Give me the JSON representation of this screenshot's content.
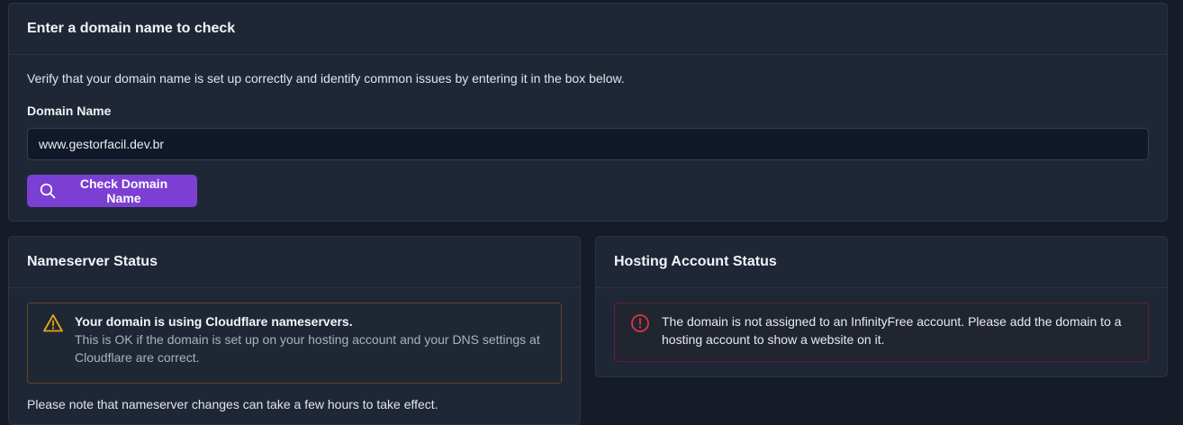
{
  "domain_check": {
    "title": "Enter a domain name to check",
    "description": "Verify that your domain name is set up correctly and identify common issues by entering it in the box below.",
    "field_label": "Domain Name",
    "input_value": "www.gestorfacil.dev.br",
    "button_label": "Check Domain Name",
    "button_icon": "search-icon"
  },
  "nameserver": {
    "title": "Nameserver Status",
    "alert_title": "Your domain is using Cloudflare nameservers.",
    "alert_text": "This is OK if the domain is set up on your hosting account and your DNS settings at Cloudflare are correct.",
    "alert_icon": "warning-icon",
    "note": "Please note that nameserver changes can take a few hours to take effect."
  },
  "hosting": {
    "title": "Hosting Account Status",
    "alert_text": "The domain is not assigned to an InfinityFree account. Please add the domain to a hosting account to show a website on it.",
    "alert_icon": "error-icon"
  },
  "colors": {
    "accent": "#7b3fd3",
    "warning": "#e6a817",
    "danger": "#dc3545",
    "background": "#151b27",
    "card": "#1f2736"
  }
}
